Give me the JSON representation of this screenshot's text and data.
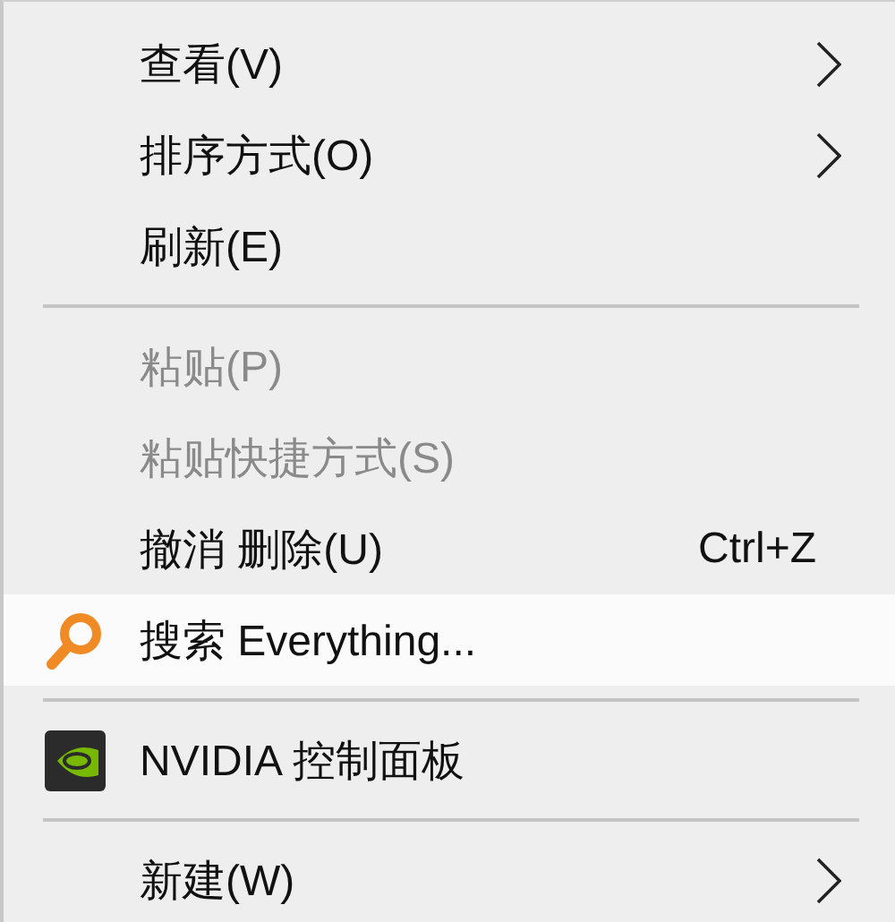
{
  "menu": {
    "items": [
      {
        "kind": "item",
        "label": "查看(V)",
        "submenu": true,
        "disabled": false,
        "selected": false
      },
      {
        "kind": "item",
        "label": "排序方式(O)",
        "submenu": true,
        "disabled": false,
        "selected": false
      },
      {
        "kind": "item",
        "label": "刷新(E)",
        "submenu": false,
        "disabled": false,
        "selected": false
      },
      {
        "kind": "separator"
      },
      {
        "kind": "item",
        "label": "粘贴(P)",
        "submenu": false,
        "disabled": true,
        "selected": false
      },
      {
        "kind": "item",
        "label": "粘贴快捷方式(S)",
        "submenu": false,
        "disabled": true,
        "selected": false
      },
      {
        "kind": "item",
        "label": "撤消 删除(U)",
        "shortcut": "Ctrl+Z",
        "submenu": false,
        "disabled": false,
        "selected": false
      },
      {
        "kind": "search-item",
        "label": "搜索 Everything...",
        "submenu": false,
        "disabled": false,
        "selected": true
      },
      {
        "kind": "separator"
      },
      {
        "kind": "app-item",
        "label": "NVIDIA 控制面板",
        "submenu": false,
        "disabled": false,
        "selected": false
      },
      {
        "kind": "separator"
      },
      {
        "kind": "item",
        "label": "新建(W)",
        "submenu": true,
        "disabled": false,
        "selected": false
      }
    ]
  }
}
